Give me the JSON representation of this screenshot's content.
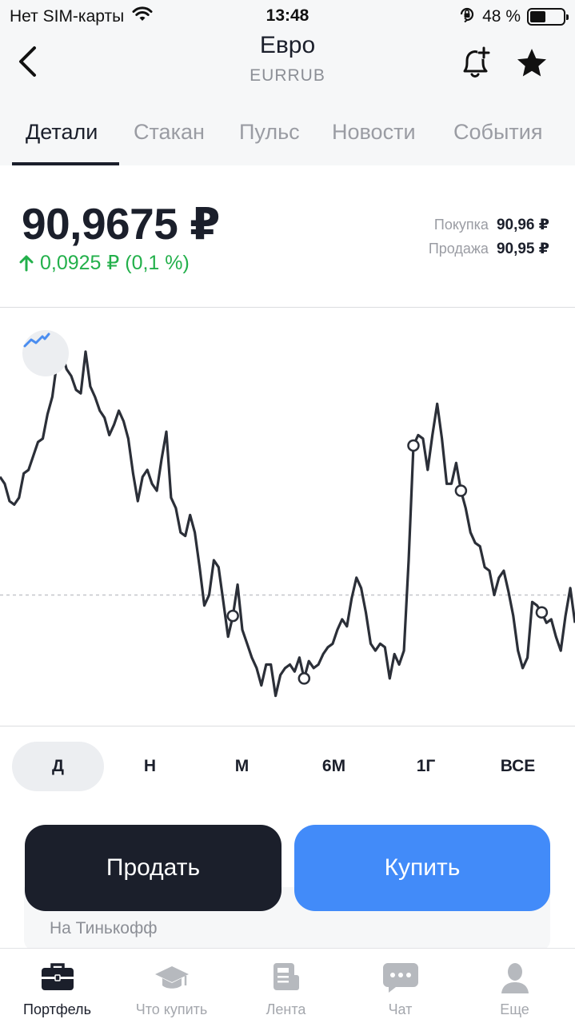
{
  "status_bar": {
    "carrier": "Нет SIM-карты",
    "time": "13:48",
    "battery": "48 %",
    "battery_level": 0.48
  },
  "header": {
    "title": "Евро",
    "ticker": "EURRUB"
  },
  "tabs": [
    {
      "label": "Детали",
      "active": true
    },
    {
      "label": "Стакан",
      "active": false
    },
    {
      "label": "Пульс",
      "active": false
    },
    {
      "label": "Новости",
      "active": false
    },
    {
      "label": "События",
      "active": false
    }
  ],
  "quote": {
    "price": "90,9675 ₽",
    "change": "0,0925 ₽ (0,1 %)",
    "change_color": "#23b04b",
    "buy_label": "Покупка",
    "buy_value": "90,96 ₽",
    "sell_label": "Продажа",
    "sell_value": "90,95 ₽"
  },
  "chart_data": {
    "type": "line",
    "y": [
      0.36,
      0.38,
      0.43,
      0.44,
      0.42,
      0.35,
      0.34,
      0.3,
      0.26,
      0.25,
      0.18,
      0.13,
      0.03,
      0.0,
      0.05,
      0.07,
      0.11,
      0.12,
      0.0,
      0.1,
      0.13,
      0.17,
      0.19,
      0.24,
      0.21,
      0.17,
      0.2,
      0.25,
      0.35,
      0.43,
      0.36,
      0.34,
      0.38,
      0.4,
      0.31,
      0.23,
      0.42,
      0.45,
      0.52,
      0.53,
      0.47,
      0.52,
      0.62,
      0.73,
      0.7,
      0.6,
      0.62,
      0.72,
      0.82,
      0.76,
      0.67,
      0.8,
      0.84,
      0.88,
      0.91,
      0.96,
      0.9,
      0.9,
      0.99,
      0.93,
      0.91,
      0.9,
      0.92,
      0.88,
      0.94,
      0.89,
      0.91,
      0.9,
      0.87,
      0.85,
      0.84,
      0.8,
      0.77,
      0.79,
      0.71,
      0.65,
      0.68,
      0.75,
      0.84,
      0.86,
      0.84,
      0.85,
      0.94,
      0.87,
      0.9,
      0.86,
      0.6,
      0.27,
      0.24,
      0.25,
      0.34,
      0.24,
      0.15,
      0.25,
      0.38,
      0.38,
      0.32,
      0.4,
      0.45,
      0.52,
      0.55,
      0.56,
      0.62,
      0.63,
      0.7,
      0.65,
      0.63,
      0.69,
      0.76,
      0.86,
      0.91,
      0.88,
      0.72,
      0.73,
      0.75,
      0.78,
      0.77,
      0.82,
      0.86,
      0.76,
      0.68,
      0.78
    ],
    "marker_indices": [
      49,
      64,
      87,
      97,
      114
    ],
    "baseline": 0.7,
    "line_color": "#2b2f38",
    "baseline_color": "#c4c6cb"
  },
  "periods": [
    {
      "label": "Д",
      "active": true
    },
    {
      "label": "Н",
      "active": false
    },
    {
      "label": "М",
      "active": false
    },
    {
      "label": "6М",
      "active": false
    },
    {
      "label": "1Г",
      "active": false
    },
    {
      "label": "ВСЕ",
      "active": false
    }
  ],
  "actions": {
    "sell_label": "Продать",
    "buy_label": "Купить",
    "exchange_label": "На Тинькофф"
  },
  "bottom_nav": [
    {
      "label": "Портфель",
      "icon": "briefcase-icon",
      "active": true
    },
    {
      "label": "Что купить",
      "icon": "graduation-cap-icon",
      "active": false
    },
    {
      "label": "Лента",
      "icon": "feed-icon",
      "active": false
    },
    {
      "label": "Чат",
      "icon": "chat-icon",
      "active": false
    },
    {
      "label": "Еще",
      "icon": "profile-icon",
      "active": false
    }
  ],
  "colors": {
    "accent_blue": "#428bf9",
    "dark": "#1b1f2b",
    "inactive": "#a4a7ad"
  }
}
